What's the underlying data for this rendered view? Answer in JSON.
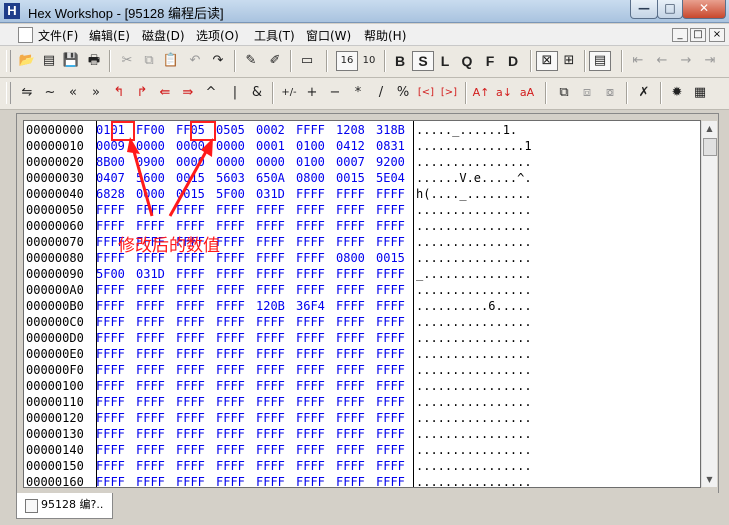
{
  "window": {
    "title": "Hex Workshop - [95128 编程后读]",
    "icon": "hex-workshop-app-icon",
    "controls": [
      "—",
      "□",
      "✕"
    ]
  },
  "menu": {
    "items": [
      "文件(F)",
      "编辑(E)",
      "磁盘(D)",
      "选项(O)",
      "工具(T)",
      "窗口(W)",
      "帮助(H)"
    ],
    "mdi_controls": [
      "_",
      "□",
      "×"
    ]
  },
  "toolbar1": {
    "buttons": [
      {
        "icon": "open-folder-icon",
        "glyph": "📂"
      },
      {
        "icon": "save-all-icon",
        "glyph": "▤"
      },
      {
        "icon": "save-icon",
        "glyph": "💾"
      },
      {
        "icon": "print-icon",
        "glyph": "🖶"
      },
      {
        "icon": "cut-icon",
        "glyph": "✂"
      },
      {
        "icon": "copy-icon",
        "glyph": "⧉"
      },
      {
        "icon": "paste-icon",
        "glyph": "📋"
      },
      {
        "icon": "undo-icon",
        "glyph": "↶"
      },
      {
        "icon": "redo-icon",
        "glyph": "↷"
      },
      {
        "icon": "find-icon",
        "glyph": "✎"
      },
      {
        "icon": "replace-icon",
        "glyph": "✐"
      },
      {
        "icon": "goto-icon",
        "glyph": "▭"
      },
      {
        "icon": "base-16-icon",
        "glyph": "16"
      },
      {
        "icon": "base-10-icon",
        "glyph": "10"
      },
      {
        "icon": "byte-icon",
        "glyph": "B"
      },
      {
        "icon": "short-icon",
        "glyph": "S"
      },
      {
        "icon": "long-icon",
        "glyph": "L"
      },
      {
        "icon": "quad-icon",
        "glyph": "Q"
      },
      {
        "icon": "float-icon",
        "glyph": "F"
      },
      {
        "icon": "double-icon",
        "glyph": "D"
      },
      {
        "icon": "checksum-icon",
        "glyph": "⊠"
      },
      {
        "icon": "new-window-icon",
        "glyph": "⊞"
      },
      {
        "icon": "view-icon",
        "glyph": "▤"
      },
      {
        "icon": "back-start-icon",
        "glyph": "⇤"
      },
      {
        "icon": "back-icon",
        "glyph": "←"
      },
      {
        "icon": "forward-icon",
        "glyph": "→"
      },
      {
        "icon": "forward-end-icon",
        "glyph": "⇥"
      }
    ]
  },
  "toolbar2": {
    "buttons": [
      {
        "icon": "swap-icon",
        "glyph": "⇋"
      },
      {
        "icon": "not-icon",
        "glyph": "~"
      },
      {
        "icon": "shift-left-icon",
        "glyph": "«"
      },
      {
        "icon": "shift-right-icon",
        "glyph": "»"
      },
      {
        "icon": "rotate-left-icon",
        "glyph": "↰"
      },
      {
        "icon": "rotate-right-icon",
        "glyph": "↱"
      },
      {
        "icon": "rotate-left-2-icon",
        "glyph": "⇚"
      },
      {
        "icon": "rotate-right-2-icon",
        "glyph": "⇛"
      },
      {
        "icon": "xor-icon",
        "glyph": "^"
      },
      {
        "icon": "or-icon",
        "glyph": "|"
      },
      {
        "icon": "and-icon",
        "glyph": "&"
      },
      {
        "icon": "negate-icon",
        "glyph": "+/-"
      },
      {
        "icon": "add-icon",
        "glyph": "+"
      },
      {
        "icon": "subtract-icon",
        "glyph": "−"
      },
      {
        "icon": "multiply-icon",
        "glyph": "*"
      },
      {
        "icon": "divide-icon",
        "glyph": "/"
      },
      {
        "icon": "modulus-icon",
        "glyph": "%"
      },
      {
        "icon": "floor-icon",
        "glyph": "[<]"
      },
      {
        "icon": "ceil-icon",
        "glyph": "[>]"
      },
      {
        "icon": "uppercase-icon",
        "glyph": "A↑"
      },
      {
        "icon": "lowercase-icon",
        "glyph": "a↓"
      },
      {
        "icon": "invert-case-icon",
        "glyph": "aA"
      },
      {
        "icon": "compare-icon",
        "glyph": "⧉"
      },
      {
        "icon": "compare-2-icon",
        "glyph": "⧈"
      },
      {
        "icon": "compare-3-icon",
        "glyph": "⧇"
      },
      {
        "icon": "bookmark-icon",
        "glyph": "✗"
      },
      {
        "icon": "settings-icon",
        "glyph": "✹"
      },
      {
        "icon": "calculator-icon",
        "glyph": "▦"
      }
    ]
  },
  "hex": {
    "rows": [
      {
        "addr": "00000000",
        "cells": [
          "0101",
          "FF00",
          "FF05",
          "0505",
          "0002",
          "FFFF",
          "1208",
          "318B"
        ],
        "ascii": "....._......1."
      },
      {
        "addr": "00000010",
        "cells": [
          "0009",
          "0000",
          "0000",
          "0000",
          "0001",
          "0100",
          "0412",
          "0831"
        ],
        "ascii": "...............1"
      },
      {
        "addr": "00000020",
        "cells": [
          "8B00",
          "0900",
          "0000",
          "0000",
          "0000",
          "0100",
          "0007",
          "9200"
        ],
        "ascii": "................"
      },
      {
        "addr": "00000030",
        "cells": [
          "0407",
          "5600",
          "0015",
          "5603",
          "650A",
          "0800",
          "0015",
          "5E04"
        ],
        "ascii": "......V.e.....^."
      },
      {
        "addr": "00000040",
        "cells": [
          "6828",
          "0000",
          "0015",
          "5F00",
          "031D",
          "FFFF",
          "FFFF",
          "FFFF"
        ],
        "ascii": "h(...._........."
      },
      {
        "addr": "00000050",
        "cells": [
          "FFFF",
          "FFFF",
          "FFFF",
          "FFFF",
          "FFFF",
          "FFFF",
          "FFFF",
          "FFFF"
        ],
        "ascii": "................"
      },
      {
        "addr": "00000060",
        "cells": [
          "FFFF",
          "FFFF",
          "FFFF",
          "FFFF",
          "FFFF",
          "FFFF",
          "FFFF",
          "FFFF"
        ],
        "ascii": "................"
      },
      {
        "addr": "00000070",
        "cells": [
          "FFFF",
          "FFFF",
          "FFFF",
          "FFFF",
          "FFFF",
          "FFFF",
          "FFFF",
          "FFFF"
        ],
        "ascii": "................"
      },
      {
        "addr": "00000080",
        "cells": [
          "FFFF",
          "FFFF",
          "FFFF",
          "FFFF",
          "FFFF",
          "FFFF",
          "0800",
          "0015"
        ],
        "ascii": "................"
      },
      {
        "addr": "00000090",
        "cells": [
          "5F00",
          "031D",
          "FFFF",
          "FFFF",
          "FFFF",
          "FFFF",
          "FFFF",
          "FFFF"
        ],
        "ascii": "_..............."
      },
      {
        "addr": "000000A0",
        "cells": [
          "FFFF",
          "FFFF",
          "FFFF",
          "FFFF",
          "FFFF",
          "FFFF",
          "FFFF",
          "FFFF"
        ],
        "ascii": "................"
      },
      {
        "addr": "000000B0",
        "cells": [
          "FFFF",
          "FFFF",
          "FFFF",
          "FFFF",
          "120B",
          "36F4",
          "FFFF",
          "FFFF"
        ],
        "ascii": "..........6....."
      },
      {
        "addr": "000000C0",
        "cells": [
          "FFFF",
          "FFFF",
          "FFFF",
          "FFFF",
          "FFFF",
          "FFFF",
          "FFFF",
          "FFFF"
        ],
        "ascii": "................"
      },
      {
        "addr": "000000D0",
        "cells": [
          "FFFF",
          "FFFF",
          "FFFF",
          "FFFF",
          "FFFF",
          "FFFF",
          "FFFF",
          "FFFF"
        ],
        "ascii": "................"
      },
      {
        "addr": "000000E0",
        "cells": [
          "FFFF",
          "FFFF",
          "FFFF",
          "FFFF",
          "FFFF",
          "FFFF",
          "FFFF",
          "FFFF"
        ],
        "ascii": "................"
      },
      {
        "addr": "000000F0",
        "cells": [
          "FFFF",
          "FFFF",
          "FFFF",
          "FFFF",
          "FFFF",
          "FFFF",
          "FFFF",
          "FFFF"
        ],
        "ascii": "................"
      },
      {
        "addr": "00000100",
        "cells": [
          "FFFF",
          "FFFF",
          "FFFF",
          "FFFF",
          "FFFF",
          "FFFF",
          "FFFF",
          "FFFF"
        ],
        "ascii": "................"
      },
      {
        "addr": "00000110",
        "cells": [
          "FFFF",
          "FFFF",
          "FFFF",
          "FFFF",
          "FFFF",
          "FFFF",
          "FFFF",
          "FFFF"
        ],
        "ascii": "................"
      },
      {
        "addr": "00000120",
        "cells": [
          "FFFF",
          "FFFF",
          "FFFF",
          "FFFF",
          "FFFF",
          "FFFF",
          "FFFF",
          "FFFF"
        ],
        "ascii": "................"
      },
      {
        "addr": "00000130",
        "cells": [
          "FFFF",
          "FFFF",
          "FFFF",
          "FFFF",
          "FFFF",
          "FFFF",
          "FFFF",
          "FFFF"
        ],
        "ascii": "................"
      },
      {
        "addr": "00000140",
        "cells": [
          "FFFF",
          "FFFF",
          "FFFF",
          "FFFF",
          "FFFF",
          "FFFF",
          "FFFF",
          "FFFF"
        ],
        "ascii": "................"
      },
      {
        "addr": "00000150",
        "cells": [
          "FFFF",
          "FFFF",
          "FFFF",
          "FFFF",
          "FFFF",
          "FFFF",
          "FFFF",
          "FFFF"
        ],
        "ascii": "................"
      },
      {
        "addr": "00000160",
        "cells": [
          "FFFF",
          "FFFF",
          "FFFF",
          "FFFF",
          "FFFF",
          "FFFF",
          "FFFF",
          "FFFF"
        ],
        "ascii": "................"
      }
    ]
  },
  "annotation": {
    "text": "修改后的数值",
    "color": "#ff1a1a"
  },
  "doc_tab": {
    "label": "95128 编?.."
  },
  "colors": {
    "hex_text": "#0000ee",
    "annotation": "#ff1a1a"
  }
}
